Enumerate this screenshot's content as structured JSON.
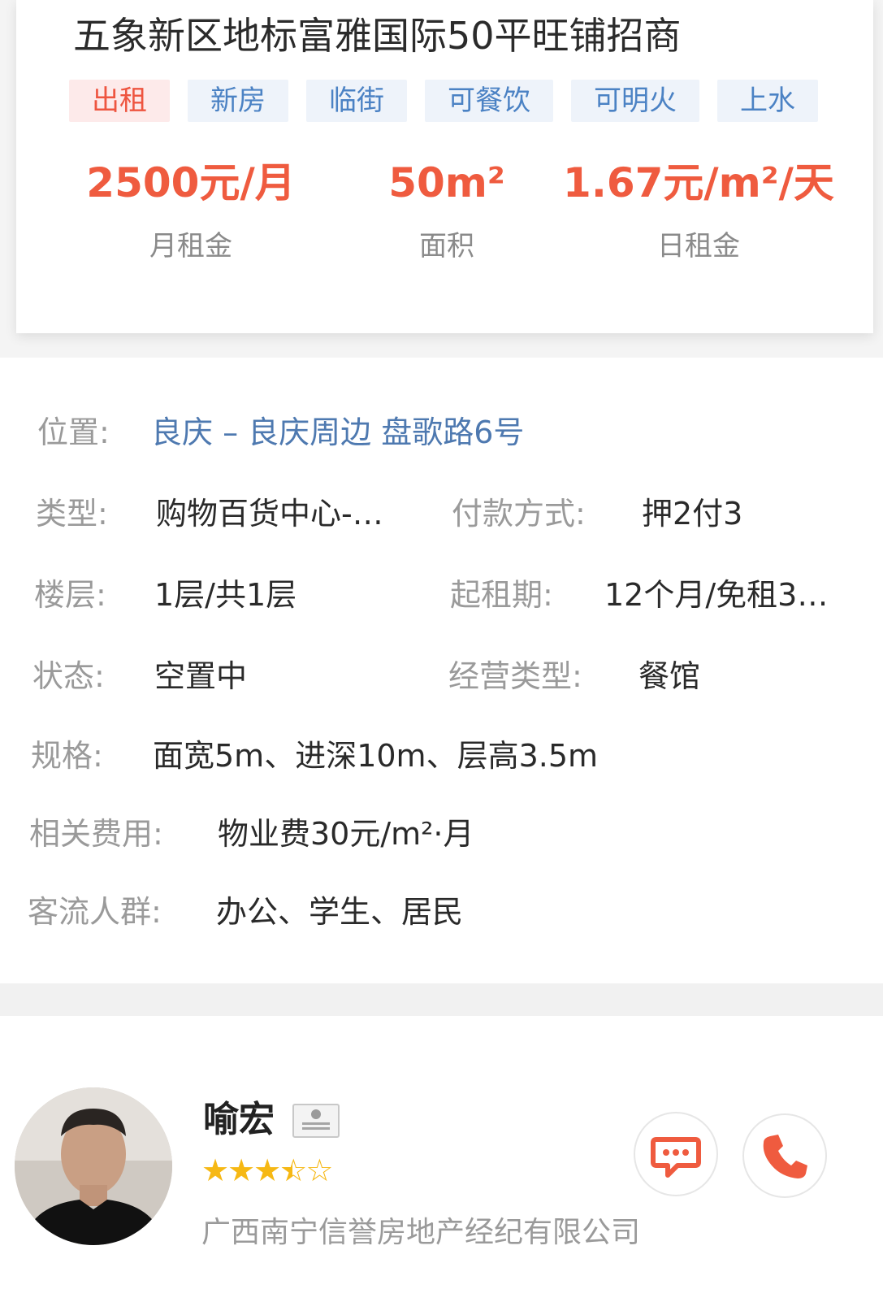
{
  "listing": {
    "title": "五象新区地标富雅国际50平旺铺招商",
    "tags": [
      "出租",
      "新房",
      "临街",
      "可餐饮",
      "可明火",
      "上水"
    ],
    "stats": [
      {
        "value": "2500元/月",
        "label": "月租金"
      },
      {
        "value": "50m²",
        "label": "面积"
      },
      {
        "value": "1.67元/m²/天",
        "label": "日租金"
      }
    ]
  },
  "details": {
    "location_label": "位置:",
    "location_value": "良庆 – 良庆周边 盘歌路6号",
    "type_label": "类型:",
    "type_value": "购物百货中心-…",
    "payment_label": "付款方式:",
    "payment_value": "押2付3",
    "floor_label": "楼层:",
    "floor_value": "1层/共1层",
    "lease_label": "起租期:",
    "lease_value": "12个月/免租3…",
    "status_label": "状态:",
    "status_value": "空置中",
    "business_label": "经营类型:",
    "business_value": "餐馆",
    "spec_label": "规格:",
    "spec_value": "面宽5m、进深10m、层高3.5m",
    "fees_label": "相关费用:",
    "fees_value": "物业费30元/m²·月",
    "crowd_label": "客流人群:",
    "crowd_value": "办公、学生、居民"
  },
  "agent": {
    "name": "喻宏",
    "rating": 3.5,
    "rating_max": 5,
    "company": "广西南宁信誉房地产经纪有限公司",
    "icons": [
      "id-card-icon",
      "chat-icon",
      "phone-icon"
    ]
  },
  "colors": {
    "accent": "#ef5b3f",
    "tag_blue": "#4b82c4",
    "link": "#4e79b0",
    "star": "#f6b814"
  }
}
